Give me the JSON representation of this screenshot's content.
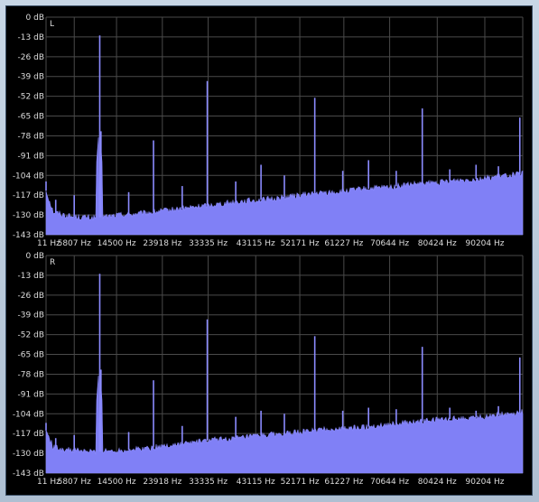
{
  "colors": {
    "background": "#000000",
    "grid": "#4a4a4a",
    "spectrum": "#8080f6",
    "text": "#dcdcdc"
  },
  "chart_data": [
    {
      "type": "area",
      "title": "",
      "channel_label": "L",
      "y_tick_labels": [
        "0 dB",
        "-13 dB",
        "-26 dB",
        "-39 dB",
        "-52 dB",
        "-65 dB",
        "-78 dB",
        "-91 dB",
        "-104 dB",
        "-117 dB",
        "-130 dB",
        "-143 dB"
      ],
      "x_tick_labels": [
        "11 Hz",
        "5807 Hz",
        "14500 Hz",
        "23918 Hz",
        "33335 Hz",
        "43115 Hz",
        "52171 Hz",
        "61227 Hz",
        "70644 Hz",
        "80424 Hz",
        "90204 Hz"
      ],
      "x_ticks_hz": [
        11,
        5807,
        14500,
        23918,
        33335,
        43115,
        52171,
        61227,
        70644,
        80424,
        90204
      ],
      "ylim": [
        -143,
        0
      ],
      "xlim": [
        11,
        98000
      ],
      "grid": true,
      "noise_floor": {
        "x": [
          11,
          1500,
          5000,
          10000,
          15000,
          20000,
          25000,
          30000,
          35000,
          40000,
          45000,
          50000,
          55000,
          60000,
          65000,
          70000,
          75000,
          80000,
          85000,
          90000,
          95000,
          98000
        ],
        "y": [
          -114,
          -128,
          -131,
          -132,
          -130,
          -129,
          -127,
          -125,
          -123,
          -121,
          -120,
          -118,
          -116,
          -115,
          -113,
          -112,
          -110,
          -109,
          -107,
          -106,
          -104,
          -103
        ]
      },
      "peaks": [
        {
          "x": 11,
          "y": -108
        },
        {
          "x": 2000,
          "y": -120
        },
        {
          "x": 5800,
          "y": -117
        },
        {
          "x": 11050,
          "y": -12
        },
        {
          "x": 11300,
          "y": -75
        },
        {
          "x": 17000,
          "y": -115
        },
        {
          "x": 22100,
          "y": -81
        },
        {
          "x": 28000,
          "y": -111
        },
        {
          "x": 33150,
          "y": -42
        },
        {
          "x": 39000,
          "y": -108
        },
        {
          "x": 44200,
          "y": -97
        },
        {
          "x": 49000,
          "y": -104
        },
        {
          "x": 55250,
          "y": -53
        },
        {
          "x": 61000,
          "y": -101
        },
        {
          "x": 66300,
          "y": -94
        },
        {
          "x": 72000,
          "y": -101
        },
        {
          "x": 77350,
          "y": -60
        },
        {
          "x": 83000,
          "y": -100
        },
        {
          "x": 88400,
          "y": -97
        },
        {
          "x": 93000,
          "y": -98
        },
        {
          "x": 97400,
          "y": -66
        }
      ]
    },
    {
      "type": "area",
      "title": "",
      "channel_label": "R",
      "y_tick_labels": [
        "0 dB",
        "-13 dB",
        "-26 dB",
        "-39 dB",
        "-52 dB",
        "-65 dB",
        "-78 dB",
        "-91 dB",
        "-104 dB",
        "-117 dB",
        "-130 dB",
        "-143 dB"
      ],
      "x_tick_labels": [
        "11 Hz",
        "5807 Hz",
        "14500 Hz",
        "23918 Hz",
        "33335 Hz",
        "43115 Hz",
        "52171 Hz",
        "61227 Hz",
        "70644 Hz",
        "80424 Hz",
        "90204 Hz"
      ],
      "x_ticks_hz": [
        11,
        5807,
        14500,
        23918,
        33335,
        43115,
        52171,
        61227,
        70644,
        80424,
        90204
      ],
      "ylim": [
        -143,
        0
      ],
      "xlim": [
        11,
        98000
      ],
      "grid": true,
      "noise_floor": {
        "x": [
          11,
          1500,
          5000,
          10000,
          15000,
          20000,
          25000,
          30000,
          35000,
          40000,
          45000,
          50000,
          55000,
          60000,
          65000,
          70000,
          75000,
          80000,
          85000,
          90000,
          95000,
          98000
        ],
        "y": [
          -115,
          -126,
          -128,
          -129,
          -128,
          -127,
          -125,
          -123,
          -121,
          -120,
          -118,
          -117,
          -115,
          -114,
          -113,
          -111,
          -110,
          -108,
          -107,
          -106,
          -104,
          -103
        ]
      },
      "peaks": [
        {
          "x": 11,
          "y": -110
        },
        {
          "x": 2000,
          "y": -120
        },
        {
          "x": 5800,
          "y": -118
        },
        {
          "x": 11050,
          "y": -12
        },
        {
          "x": 11300,
          "y": -75
        },
        {
          "x": 17000,
          "y": -116
        },
        {
          "x": 22100,
          "y": -82
        },
        {
          "x": 28000,
          "y": -112
        },
        {
          "x": 33150,
          "y": -42
        },
        {
          "x": 39000,
          "y": -106
        },
        {
          "x": 44200,
          "y": -102
        },
        {
          "x": 49000,
          "y": -104
        },
        {
          "x": 55250,
          "y": -53
        },
        {
          "x": 61000,
          "y": -102
        },
        {
          "x": 66300,
          "y": -100
        },
        {
          "x": 72000,
          "y": -101
        },
        {
          "x": 77350,
          "y": -60
        },
        {
          "x": 83000,
          "y": -100
        },
        {
          "x": 88400,
          "y": -102
        },
        {
          "x": 93000,
          "y": -99
        },
        {
          "x": 97400,
          "y": -67
        }
      ]
    }
  ]
}
